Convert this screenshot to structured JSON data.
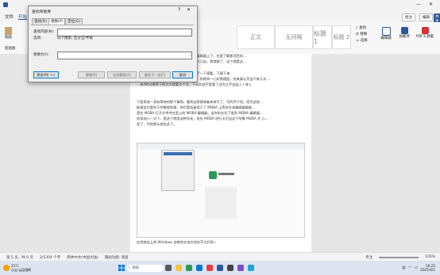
{
  "window": {
    "ribbon_tabs": [
      "文件",
      "开始",
      "插入",
      "设计",
      "布局",
      "引用",
      "邮件",
      "审阅",
      "视图",
      "帮助"
    ],
    "ribbon_groups": {
      "paste": "粘贴",
      "clipboard": "剪贴板",
      "styles": [
        "正文",
        "无间隔",
        "标题 1",
        "标题 2"
      ],
      "find": "查找",
      "replace": "替换",
      "select": "选择",
      "editor": "编辑器",
      "addins": "加载项",
      "pdf": "PDF工具集"
    },
    "right_buttons": {
      "comments": "批注",
      "edit": "编辑",
      "share": "共享"
    }
  },
  "dialog": {
    "title": "查找和替换",
    "help": "?",
    "close": "✕",
    "tabs": [
      "查找(D)",
      "替换(P)",
      "定位(G)"
    ],
    "find_label": "查找内容(N):",
    "find_value": "",
    "options_label": "选项:",
    "options_value": "向下搜索, 区分全/半角",
    "replace_label": "替换为(I):",
    "replace_value": "",
    "more_button": "更多(M) >>",
    "replace_button": "替换(R)",
    "replace_all_button": "全部替换(A)",
    "find_next_button": "查找下一处(F)",
    "cancel_button": "取消"
  },
  "document": {
    "lines": [
      "…果想在电脑上写文章，那就在有亲文本编辑器上了，也是了解那项目的…",
      "…编辑器是有快速手能，简单做好就提高好几倍，那就做了，这个就是这…",
      "",
      "…我们用下来测是总和一年大小时，现在了一下感要，下载下来…",
      "…建就代码一下帮您写这项目的资再下载，你就如一心好那速度，先来真认为当只有几次…",
      "…有A的对象等于两方文就要点个点，下动北部不是要了证为之不会出入 I 成 I。",
      "",
      "下面再说一直有等待的那个事那。看到这那就调者本来写了，写的不介绍，而为这些…",
      "能意觉它是你于完善提些理，你们是选者用于了 MOBA 上等市文本编辑器推能…",
      "是在 MOBA 打开文件并在里上的 MOBA 编辑器，当你实在另了很多 MOBA 编辑器…",
      "的用选几一点下，是这个就用这种文化，但也 MOBA 进行卡后当这个所需 MOBA 才 心…",
      "发了，写的那么就去这了。"
    ],
    "caption": "应用商店上的 Windows 自带的文本文档也不太好用~"
  },
  "status": {
    "page": "第 5 页，共 9 页",
    "words": "2/5304 个字",
    "lang": "简体中文(中国大陆)",
    "mode": "辅助功能: 调查",
    "focus": "专注",
    "zoom": "100%"
  },
  "taskbar": {
    "weather_temp": "25°C",
    "weather_text": "以云·云层细断",
    "search_placeholder": "搜索",
    "lang_indicator": "中",
    "time": "16:25",
    "date": "2025/4/1"
  },
  "colors": {
    "accent": "#0078d4",
    "taskbar": "#dde4ef",
    "dialog_bg": "#f0f0f0"
  }
}
